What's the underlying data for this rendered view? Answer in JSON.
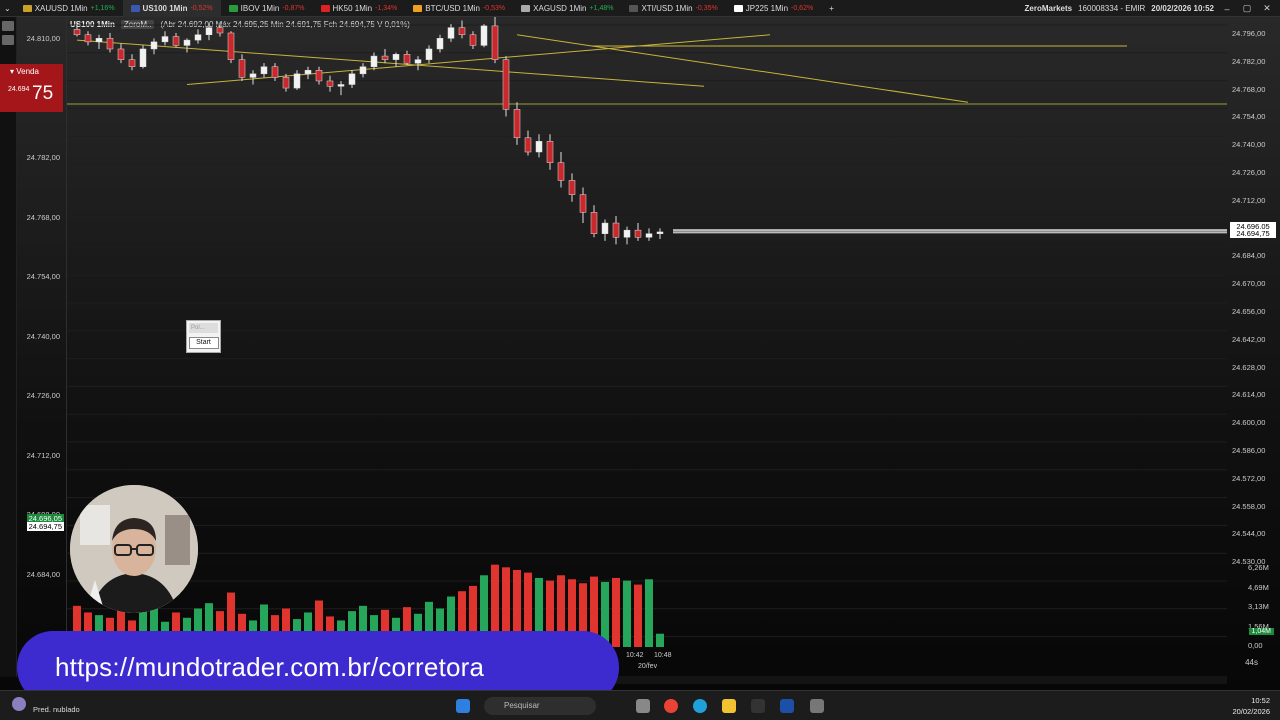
{
  "tabs": [
    {
      "label": "XAUUSD 1Min",
      "change": "+1,16%",
      "dir": "up",
      "flag": "#c9a227"
    },
    {
      "label": "US100 1Min",
      "change": "-0,52%",
      "dir": "down",
      "flag": "#3c58b0",
      "active": true
    },
    {
      "label": "IBOV 1Min",
      "change": "-0,87%",
      "dir": "down",
      "flag": "#2b9a3e"
    },
    {
      "label": "HK50 1Min",
      "change": "-1,34%",
      "dir": "down",
      "flag": "#d22"
    },
    {
      "label": "BTC/USD 1Min",
      "change": "-0,53%",
      "dir": "down",
      "flag": "#f0a020"
    },
    {
      "label": "XAGUSD 1Min",
      "change": "+1,48%",
      "dir": "up",
      "flag": "#aaa"
    },
    {
      "label": "XTI/USD 1Min",
      "change": "-0,35%",
      "dir": "down",
      "flag": "#555"
    },
    {
      "label": "JP225 1Min",
      "change": "-0,62%",
      "dir": "down",
      "flag": "#fff"
    }
  ],
  "account": {
    "broker": "ZeroMarkets",
    "number": "160008334 - EMIR",
    "datetime": "20/02/2026 10:52"
  },
  "infobar": {
    "symbol": "US100 1Min",
    "pill": "ZeroM..",
    "ohlc": "(Abr 24.692,00 Máx 24.695,25 Min 24.691,75 Fch 24.694,75 V 0,01%)"
  },
  "order": {
    "label": "Venda",
    "price_small": "24.694",
    "price_big": "75"
  },
  "left_axis": [
    "24.810,00",
    "24.796,00",
    "24.782,00",
    "24.768,00",
    "24.754,00",
    "24.740,00",
    "24.726,00",
    "24.712,00",
    "24.698,00",
    "24.684,00"
  ],
  "left_tags": [
    "24.696,05",
    "24.694,75"
  ],
  "right_axis": [
    "24.796,00",
    "24.782,00",
    "24.768,00",
    "24.754,00",
    "24.740,00",
    "24.726,00",
    "24.712,00",
    "24.698,00",
    "24.684,00",
    "24.670,00",
    "24.656,00",
    "24.642,00",
    "24.628,00",
    "24.614,00",
    "24.600,00",
    "24.586,00",
    "24.572,00",
    "24.558,00",
    "24.544,00",
    "24.530,00"
  ],
  "right_tags": [
    "24.696,05",
    "24.694,75"
  ],
  "volume_axis": [
    "6,26M",
    "4,69M",
    "3,13M",
    "1,56M",
    "0,00"
  ],
  "volume_tag": "1,04M",
  "time_labels": {
    "t1": "10:42",
    "t2": "10:48",
    "date": "20/fev"
  },
  "widget": {
    "field": "Pol...",
    "button": "Start"
  },
  "seconds": "44s",
  "banner": "https://mundotrader.com.br/corretora",
  "taskbar": {
    "weather": "Pred. nublado",
    "search": "Pesquisar",
    "time": "10:52",
    "date": "20/02/2026"
  },
  "colors": {
    "bull": "#26a65b",
    "bear": "#e0352f",
    "trendline": "#c8b43a",
    "banner": "#3d2bd0"
  },
  "chart_data": {
    "type": "candlestick",
    "title": "US100 1Min",
    "ylim": [
      24664,
      24816
    ],
    "candles": [
      [
        24809,
        24812,
        24805,
        24806
      ],
      [
        24806,
        24808,
        24800,
        24802
      ],
      [
        24802,
        24806,
        24798,
        24804
      ],
      [
        24804,
        24807,
        24796,
        24798
      ],
      [
        24798,
        24801,
        24790,
        24792
      ],
      [
        24792,
        24795,
        24786,
        24788
      ],
      [
        24788,
        24800,
        24787,
        24798
      ],
      [
        24798,
        24804,
        24795,
        24802
      ],
      [
        24802,
        24808,
        24800,
        24805
      ],
      [
        24805,
        24807,
        24799,
        24800
      ],
      [
        24800,
        24804,
        24796,
        24803
      ],
      [
        24803,
        24809,
        24801,
        24806
      ],
      [
        24806,
        24812,
        24803,
        24810
      ],
      [
        24810,
        24813,
        24805,
        24807
      ],
      [
        24807,
        24808,
        24790,
        24792
      ],
      [
        24792,
        24795,
        24780,
        24782
      ],
      [
        24782,
        24786,
        24778,
        24784
      ],
      [
        24784,
        24790,
        24782,
        24788
      ],
      [
        24788,
        24790,
        24780,
        24782
      ],
      [
        24782,
        24784,
        24774,
        24776
      ],
      [
        24776,
        24786,
        24775,
        24784
      ],
      [
        24784,
        24788,
        24781,
        24786
      ],
      [
        24786,
        24788,
        24778,
        24780
      ],
      [
        24780,
        24783,
        24774,
        24777
      ],
      [
        24777,
        24780,
        24772,
        24778
      ],
      [
        24778,
        24786,
        24776,
        24784
      ],
      [
        24784,
        24790,
        24782,
        24788
      ],
      [
        24788,
        24796,
        24786,
        24794
      ],
      [
        24794,
        24798,
        24790,
        24792
      ],
      [
        24792,
        24796,
        24788,
        24795
      ],
      [
        24795,
        24797,
        24789,
        24790
      ],
      [
        24790,
        24794,
        24786,
        24792
      ],
      [
        24792,
        24800,
        24790,
        24798
      ],
      [
        24798,
        24806,
        24796,
        24804
      ],
      [
        24804,
        24812,
        24802,
        24810
      ],
      [
        24810,
        24814,
        24804,
        24806
      ],
      [
        24806,
        24808,
        24798,
        24800
      ],
      [
        24800,
        24812,
        24799,
        24811
      ],
      [
        24811,
        24816,
        24790,
        24792
      ],
      [
        24792,
        24794,
        24760,
        24764
      ],
      [
        24764,
        24768,
        24744,
        24748
      ],
      [
        24748,
        24752,
        24738,
        24740
      ],
      [
        24740,
        24750,
        24737,
        24746
      ],
      [
        24746,
        24750,
        24730,
        24734
      ],
      [
        24734,
        24740,
        24720,
        24724
      ],
      [
        24724,
        24728,
        24712,
        24716
      ],
      [
        24716,
        24720,
        24700,
        24706
      ],
      [
        24706,
        24710,
        24692,
        24694
      ],
      [
        24694,
        24702,
        24690,
        24700
      ],
      [
        24700,
        24704,
        24688,
        24692
      ],
      [
        24692,
        24698,
        24688,
        24696
      ],
      [
        24696,
        24700,
        24690,
        24692
      ],
      [
        24692,
        24697,
        24690,
        24694
      ],
      [
        24694,
        24697,
        24691,
        24695
      ]
    ],
    "volume": [
      3.1,
      2.6,
      2.4,
      2.2,
      3.4,
      2.0,
      2.8,
      3.0,
      1.9,
      2.6,
      2.2,
      2.9,
      3.3,
      2.7,
      4.1,
      2.5,
      2.0,
      3.2,
      2.4,
      2.9,
      2.1,
      2.6,
      3.5,
      2.3,
      2.0,
      2.7,
      3.1,
      2.4,
      2.8,
      2.2,
      3.0,
      2.5,
      3.4,
      2.9,
      3.8,
      4.2,
      4.6,
      5.4,
      6.2,
      6.0,
      5.8,
      5.6,
      5.2,
      5.0,
      5.4,
      5.1,
      4.8,
      5.3,
      4.9,
      5.2,
      5.0,
      4.7,
      5.1,
      1.0
    ],
    "hlines": [
      24767,
      24696.05,
      24694.75
    ],
    "trendlines": [
      {
        "from": [
          0,
          24803
        ],
        "to": [
          57,
          24777
        ]
      },
      {
        "from": [
          10,
          24778
        ],
        "to": [
          63,
          24806
        ]
      },
      {
        "from": [
          40,
          24806
        ],
        "to": [
          81,
          24768
        ]
      }
    ]
  }
}
